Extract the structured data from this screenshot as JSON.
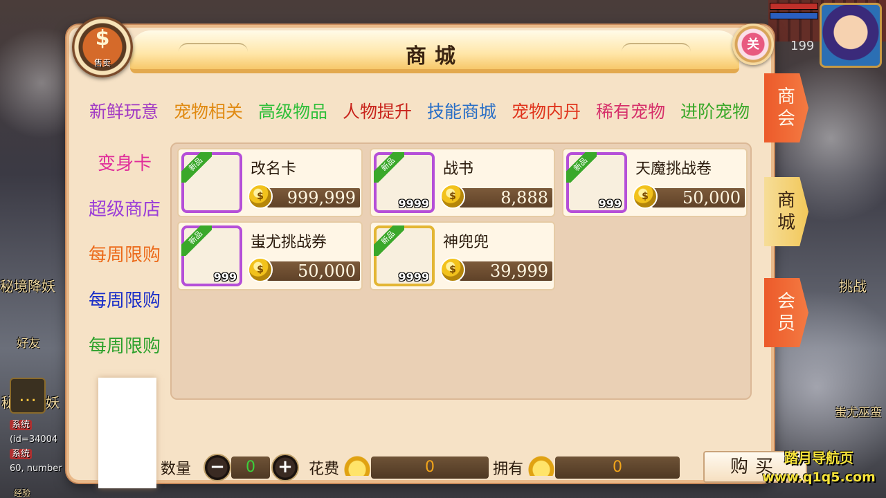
{
  "scene": {
    "player_level": "199",
    "left_label_1": "秘境降妖",
    "left_label_2": "好友",
    "left_label_3": "秘",
    "left_label_4": "妖",
    "right_label_1": "挑战",
    "right_label_2": "蚩尤巫蛮",
    "sys_tag": "系统",
    "sys_line_1": "(id=34004",
    "sys_line_2": "60, number",
    "xp_label": "经验"
  },
  "watermark": {
    "line1": "踏月导航页",
    "line2": "www.q1q5.com"
  },
  "window": {
    "title": "商城",
    "sell_glyph": "$",
    "sell_label": "售卖",
    "close_glyph": "关"
  },
  "category_tabs": [
    {
      "label": "新鲜玩意",
      "color": "#a23bc4",
      "active": false
    },
    {
      "label": "宠物相关",
      "color": "#e08a12",
      "active": false
    },
    {
      "label": "高级物品",
      "color": "#2fbf3a",
      "active": true
    },
    {
      "label": "人物提升",
      "color": "#c8241c",
      "active": false
    },
    {
      "label": "技能商城",
      "color": "#2a6fc6",
      "active": false
    },
    {
      "label": "宠物内丹",
      "color": "#e0341c",
      "active": false
    },
    {
      "label": "稀有宠物",
      "color": "#d6306a",
      "active": false
    },
    {
      "label": "进阶宠物",
      "color": "#3aa82a",
      "active": false
    }
  ],
  "side_tabs": [
    {
      "label": "变身卡",
      "color": "#e02c9a"
    },
    {
      "label": "超级商店",
      "color": "#9a3ed8"
    },
    {
      "label": "每周限购",
      "color": "#ec6a1a"
    },
    {
      "label": "每周限购",
      "color": "#1a2ec8"
    },
    {
      "label": "每周限购",
      "color": "#2aa02a"
    }
  ],
  "products": [
    {
      "name": "改名卡",
      "price": "999,999",
      "qty": "",
      "new_tag": "新品",
      "frame": "purple",
      "art": "scroll-icon"
    },
    {
      "name": "战书",
      "price": "8,888",
      "qty": "9999",
      "new_tag": "新品",
      "frame": "purple",
      "art": "war-scroll-icon"
    },
    {
      "name": "天魔挑战卷",
      "price": "50,000",
      "qty": "999",
      "new_tag": "新品",
      "frame": "purple",
      "art": "red-scroll-icon"
    },
    {
      "name": "蚩尤挑战券",
      "price": "50,000",
      "qty": "999",
      "new_tag": "新品",
      "frame": "purple",
      "art": "jade-tag-icon"
    },
    {
      "name": "神兜兜",
      "price": "39,999",
      "qty": "9999",
      "new_tag": "新品",
      "frame": "gold",
      "art": "pig-bag-icon"
    }
  ],
  "coin_glyph": "$",
  "right_tabs": [
    {
      "label": "商会",
      "active": false
    },
    {
      "label": "商城",
      "active": true
    },
    {
      "label": "会员",
      "active": false
    }
  ],
  "bottom": {
    "qty_label": "数量",
    "minus_glyph": "−",
    "plus_glyph": "+",
    "qty_value": "0",
    "cost_label": "花费",
    "cost_value": "0",
    "own_label": "拥有",
    "own_value": "0",
    "buy_label": "购买"
  }
}
